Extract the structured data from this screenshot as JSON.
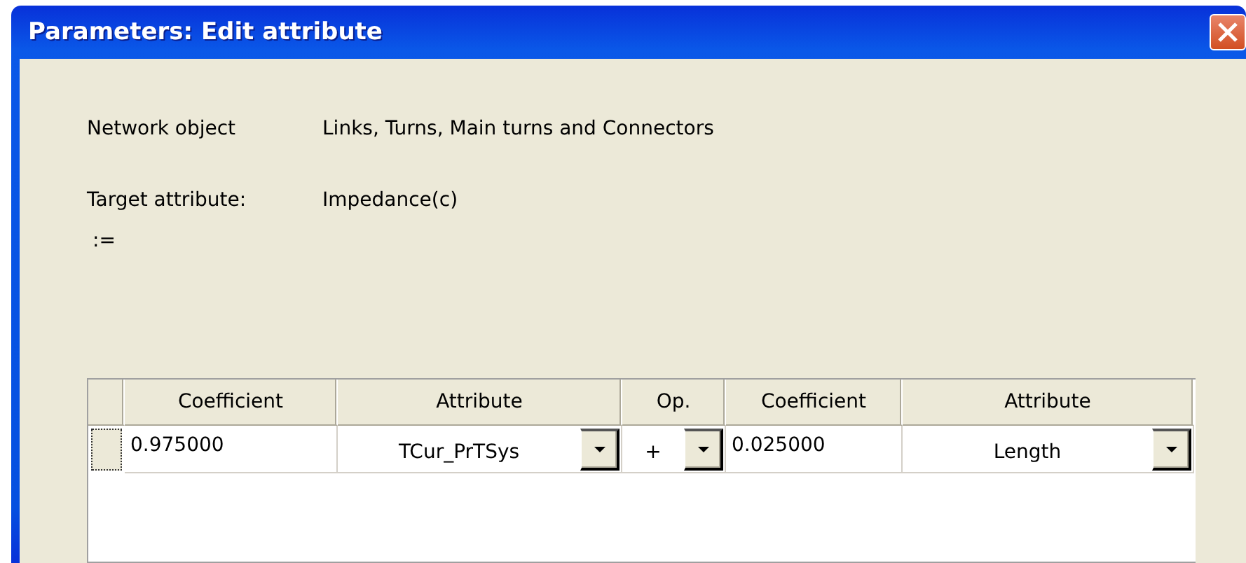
{
  "window": {
    "title": "Parameters: Edit attribute"
  },
  "fields": [
    {
      "label": "Network object",
      "value": "Links, Turns, Main turns and Connectors"
    },
    {
      "label": "Target attribute:",
      "value": "Impedance(c)"
    }
  ],
  "assign_symbol": ":=",
  "table": {
    "columns": [
      "Coefficient",
      "Attribute",
      "Op.",
      "Coefficient",
      "Attribute"
    ],
    "rows": [
      {
        "selected": false,
        "cells": [
          {
            "kind": "text",
            "value": "0.975000"
          },
          {
            "kind": "dropdown",
            "value": "TCur_PrTSys"
          },
          {
            "kind": "dropdown",
            "value": "+"
          },
          {
            "kind": "text",
            "value": "0.025000"
          },
          {
            "kind": "dropdown",
            "value": "Length"
          }
        ]
      }
    ]
  }
}
